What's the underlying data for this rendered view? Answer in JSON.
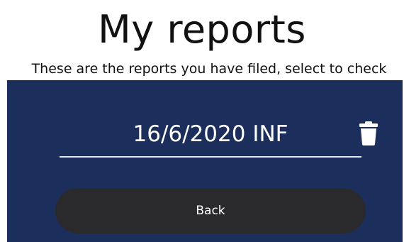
{
  "header": {
    "title": "My reports",
    "subtitle": "These are the reports you have filed, select to check"
  },
  "reports": {
    "items": [
      {
        "label": "16/6/2020 INF",
        "delete_icon": "trash-icon"
      }
    ]
  },
  "actions": {
    "back_label": "Back"
  },
  "colors": {
    "panel": "#1c2f5c",
    "button": "#2a2a2c",
    "text_light": "#ffffff",
    "text_dark": "#111111"
  }
}
